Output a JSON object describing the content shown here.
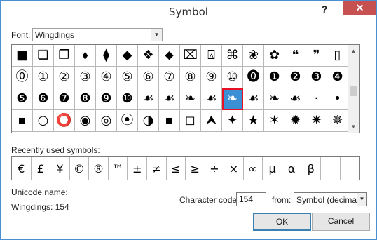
{
  "window": {
    "title": "Symbol",
    "help_label": "?",
    "close_label": "✕"
  },
  "font": {
    "label_key": "F",
    "label_rest": "ont:",
    "value": "Wingdings"
  },
  "symbol_grid": [
    [
      "■",
      "❏",
      "❐",
      "⬧",
      "⧫",
      "◆",
      "❖",
      "⬥",
      "⌧",
      "⍓",
      "⌘",
      "❀",
      "✿",
      "❝",
      "❞",
      "▯"
    ],
    [
      "⓪",
      "①",
      "②",
      "③",
      "④",
      "⑤",
      "⑥",
      "⑦",
      "⑧",
      "⑨",
      "⑩",
      "⓿",
      "❶",
      "❷",
      "❸",
      "❹"
    ],
    [
      "❺",
      "❻",
      "❼",
      "❽",
      "❾",
      "❿",
      "☙",
      "☙",
      "❧",
      "☙",
      "❧",
      "☙",
      "❧",
      "☙",
      "·",
      "•"
    ],
    [
      "▪",
      "○",
      "⭕",
      "◉",
      "◎",
      "⦿",
      "◑",
      "▪",
      "◻",
      "⮝",
      "✦",
      "★",
      "✶",
      "✹",
      "✷",
      "✵"
    ]
  ],
  "selected": {
    "row": 2,
    "col": 10
  },
  "recent": {
    "label": "Recently used symbols:",
    "symbols": [
      "€",
      "£",
      "¥",
      "©",
      "®",
      "™",
      "±",
      "≠",
      "≤",
      "≥",
      "÷",
      "×",
      "∞",
      "µ",
      "α",
      "β",
      "",
      ""
    ]
  },
  "unicode": {
    "label": "Unicode name:",
    "value": "Wingdings: 154"
  },
  "char_code": {
    "label_key": "C",
    "label_rest": "haracter code:",
    "value": "154"
  },
  "from": {
    "label_before": "fr",
    "label_key": "o",
    "label_after": "m:",
    "value": "Symbol (decimal)"
  },
  "buttons": {
    "ok": "OK",
    "cancel": "Cancel"
  },
  "colors": {
    "selection": "#3b8fd4",
    "selection_outline": "#e81123",
    "close_button": "#c75050"
  }
}
